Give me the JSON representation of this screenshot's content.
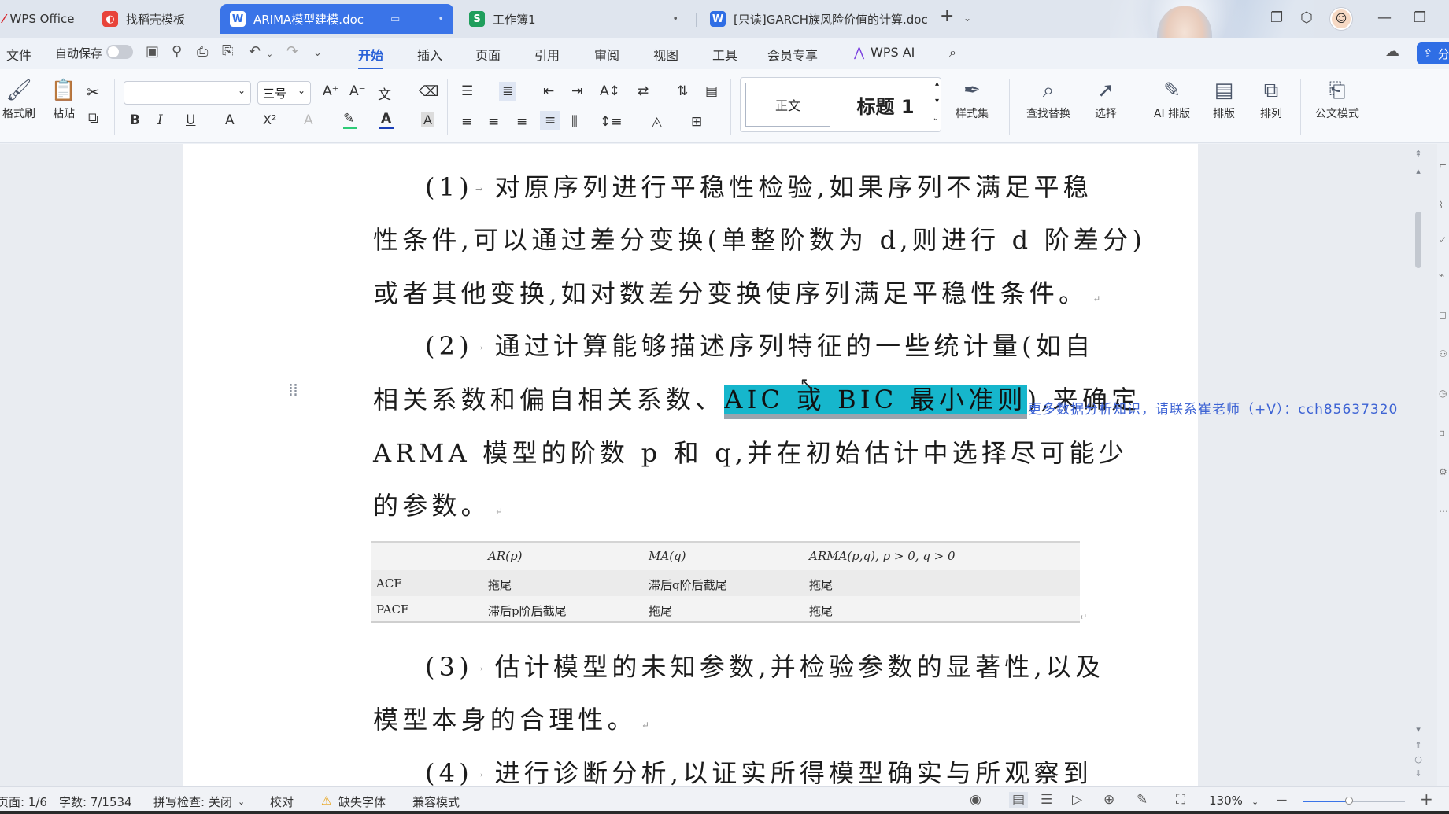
{
  "tabs": [
    {
      "label": "WPS Office",
      "icon": "wps-logo"
    },
    {
      "label": "找稻壳模板",
      "icon": "docer-icon"
    },
    {
      "label": "ARIMA模型建模.doc",
      "icon": "word-icon"
    },
    {
      "label": "工作簿1",
      "icon": "sheet-icon"
    },
    {
      "label": "[只读]GARCH族风险价值的计算.doc",
      "icon": "word-icon"
    }
  ],
  "tab_icon_letters": {
    "word": "W",
    "sheet": "S"
  },
  "menu": {
    "file": "文件",
    "autosave": "自动保存",
    "items": [
      "开始",
      "插入",
      "页面",
      "引用",
      "审阅",
      "视图",
      "工具",
      "会员专享",
      "WPS AI"
    ],
    "share": "分"
  },
  "ribbon": {
    "format_painter": "格式刷",
    "paste": "粘贴",
    "font_size": "三号",
    "style_normal": "正文",
    "style_heading": "标题 1",
    "style_set": "样式集",
    "find_replace": "查找替换",
    "select": "选择",
    "ai_layout": "AI 排版",
    "layout": "排版",
    "arrange": "排列",
    "official_mode": "公文模式",
    "bold": "B",
    "italic": "I",
    "underline": "U",
    "strike": "A",
    "superscript": "X²",
    "font_color": "A",
    "char_shading": "A"
  },
  "colors": {
    "accent": "#3a74e8",
    "selection": "#16b6cc",
    "highlight_yellow": "#f2d21b",
    "font_red": "#1a3fb8",
    "watermark": "#3d63d4"
  },
  "document": {
    "lines": [
      {
        "pre": "(1)",
        "text": "对原序列进行平稳性检验,如果序列不满足平稳"
      },
      {
        "text": "性条件,可以通过差分变换(单整阶数为 d,则进行 d 阶差分)"
      },
      {
        "text": "或者其他变换,如对数差分变换使序列满足平稳性条件。"
      },
      {
        "pre": "(2)",
        "text": "通过计算能够描述序列特征的一些统计量(如自"
      },
      {
        "before": "相关系数和偏自相关系数、",
        "selected": "AIC 或 BIC 最小准则",
        "after": "),来确定"
      },
      {
        "text": "ARMA 模型的阶数 p 和 q,并在初始估计中选择尽可能少"
      },
      {
        "text": "的参数。"
      },
      {
        "pre": "(3)",
        "text": "估计模型的未知参数,并检验参数的显著性,以及"
      },
      {
        "text": "模型本身的合理性。"
      },
      {
        "pre": "(4)",
        "text": "进行诊断分析,以证实所得模型确实与所观察到"
      }
    ],
    "para_mark": "↵",
    "tab_mark": "→"
  },
  "table": {
    "header": [
      "",
      "AR(p)",
      "MA(q)",
      "ARMA(p,q), p > 0, q > 0"
    ],
    "rows": [
      [
        "ACF",
        "拖尾",
        "滞后q阶后截尾",
        "拖尾"
      ],
      [
        "PACF",
        "滞后p阶后截尾",
        "拖尾",
        "拖尾"
      ]
    ]
  },
  "watermark": "更多数据分析知识，请联系崔老师（+V）：cch85637320",
  "status": {
    "page": "页面: 1/6",
    "words": "字数: 7/1534",
    "spell": "拼写检查: 关闭",
    "proof": "校对",
    "missing_font": "缺失字体",
    "compat": "兼容模式",
    "zoom": "130%",
    "zoom_level": 0.45
  }
}
